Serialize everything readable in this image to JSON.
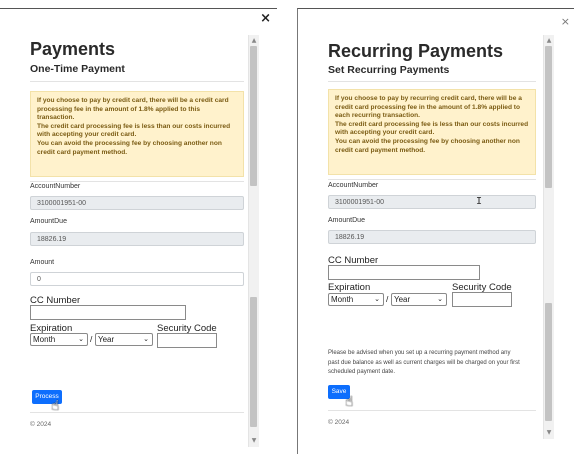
{
  "left": {
    "close_icon": "×",
    "title": "Payments",
    "subtitle": "One-Time Payment",
    "notice_lines": [
      "If you choose to pay by credit card, there will be a credit card",
      "processing fee in the amount of 1.8% applied to this",
      "transaction.",
      "The credit card processing fee is less than our costs incurred",
      "with accepting your credit card.",
      "You can avoid the processing fee by choosing another non",
      "credit card payment method."
    ],
    "account_number_label": "AccountNumber",
    "account_number_value": "3100001951-00",
    "amount_due_label": "AmountDue",
    "amount_due_value": "18826.19",
    "amount_label": "Amount",
    "amount_value": "0",
    "cc_number_label": "CC Number",
    "expiration_label": "Expiration",
    "security_code_label": "Security Code",
    "month_select": "Month",
    "year_select": "Year",
    "slash": "/",
    "process_button": "Process",
    "footer": "© 2024"
  },
  "right": {
    "close_icon": "×",
    "title": "Recurring Payments",
    "subtitle": "Set Recurring Payments",
    "notice_lines": [
      "If you choose to pay by recurring credit card, there will be a",
      "credit card processing fee in the amount of 1.8% applied to",
      "each recurring transaction.",
      "The credit card processing fee is less than our costs incurred",
      "with accepting your credit card.",
      "You can avoid the processing fee by choosing another non",
      "credit card payment method."
    ],
    "account_number_label": "AccountNumber",
    "account_number_value": "3100001951-00",
    "amount_due_label": "AmountDue",
    "amount_due_value": "18826.19",
    "cc_number_label": "CC Number",
    "expiration_label": "Expiration",
    "security_code_label": "Security Code",
    "month_select": "Month",
    "year_select": "Year",
    "slash": "/",
    "advisory_lines": [
      "Please be advised when you set up a recurring payment method any",
      "past due balance as well as current charges will be charged on your first",
      "scheduled payment date."
    ],
    "save_button": "Save",
    "footer": "© 2024"
  },
  "colors": {
    "primary_button": "#0d6efd",
    "notice_background": "#fff2cc",
    "notice_text": "#7b5c14",
    "readonly_field": "#e9ecef"
  },
  "icons": {
    "close": "close-icon",
    "pointer": "hand-pointer-icon",
    "text_cursor": "text-cursor-icon"
  }
}
